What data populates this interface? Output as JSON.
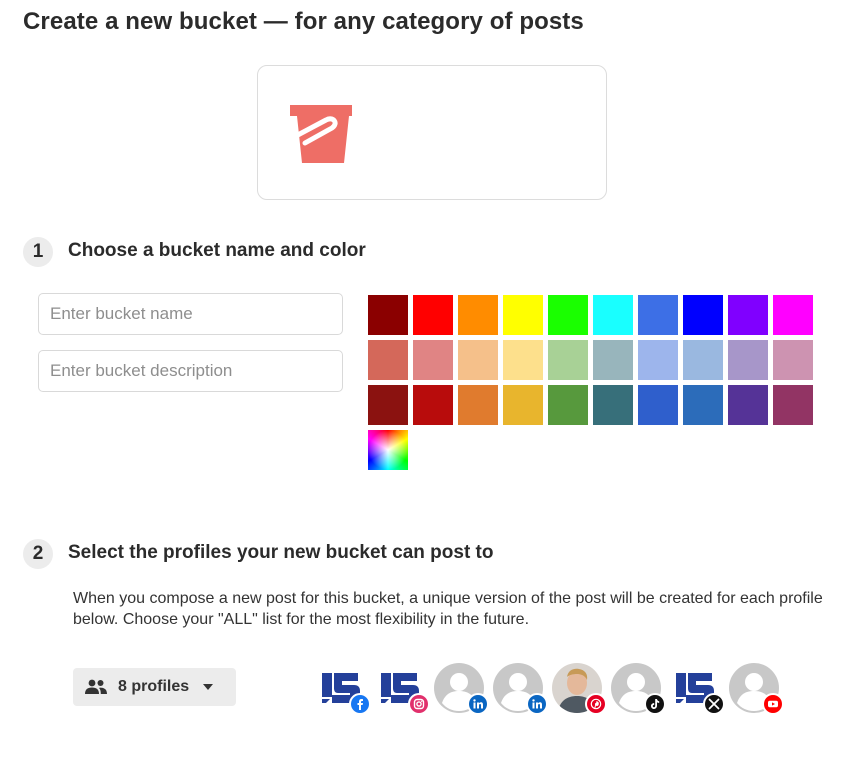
{
  "page": {
    "title": "Create a new bucket — for any category of posts"
  },
  "preview": {
    "icon": "bucket-icon",
    "color": "#ee6e66"
  },
  "step1": {
    "number": "1",
    "title": "Choose a bucket name and color",
    "name_placeholder": "Enter bucket name",
    "description_placeholder": "Enter bucket description",
    "colors": [
      [
        "#8b0000",
        "#ff0000",
        "#ff8c00",
        "#ffff00",
        "#1aff00",
        "#19ffff",
        "#3d6fe6",
        "#0000ff",
        "#8000ff",
        "#ff00ff"
      ],
      [
        "#d4685a",
        "#e08484",
        "#f5c08a",
        "#fde08c",
        "#a8d196",
        "#98b5bc",
        "#9db5ec",
        "#9ab8e0",
        "#a796c9",
        "#cd93b1"
      ],
      [
        "#8b1210",
        "#b80c0c",
        "#e07b2e",
        "#e8b52d",
        "#57993d",
        "#376f7a",
        "#2f5fcc",
        "#2c6cba",
        "#553397",
        "#923464"
      ]
    ],
    "custom_color_icon": "color-spectrum-picker"
  },
  "step2": {
    "number": "2",
    "title": "Select the profiles your new bucket can post to",
    "description": "When you compose a new post for this bucket, a unique version of the post will be created for each profile below. Choose your \"ALL\" list for the most flexibility in the future.",
    "profiles_button": {
      "icon": "people-icon",
      "label": "8 profiles",
      "caret": "caret-down-icon"
    },
    "profiles": [
      {
        "avatar": "brand-logo",
        "network": "facebook",
        "badge_color": "#1877f2"
      },
      {
        "avatar": "brand-logo",
        "network": "instagram",
        "badge_color": "#e1306c"
      },
      {
        "avatar": "placeholder",
        "network": "linkedin",
        "badge_color": "#0a66c2"
      },
      {
        "avatar": "placeholder",
        "network": "linkedin",
        "badge_color": "#0a66c2"
      },
      {
        "avatar": "photo",
        "network": "pinterest",
        "badge_color": "#e60023"
      },
      {
        "avatar": "placeholder",
        "network": "tiktok",
        "badge_color": "#111111"
      },
      {
        "avatar": "brand-logo",
        "network": "x",
        "badge_color": "#111111"
      },
      {
        "avatar": "placeholder",
        "network": "youtube",
        "badge_color": "#ff0000"
      }
    ]
  }
}
